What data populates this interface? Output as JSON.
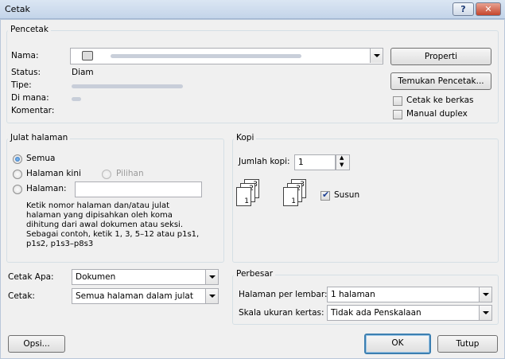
{
  "window": {
    "title": "Cetak",
    "help": "?",
    "close": "✕"
  },
  "printer": {
    "group_label": "Pencetak",
    "name_label": "Nama:",
    "status_label": "Status:",
    "status_value": "Diam",
    "type_label": "Tipe:",
    "where_label": "Di mana:",
    "comment_label": "Komentar:",
    "properties_button": "Properti",
    "find_button": "Temukan Pencetak...",
    "print_to_file_label": "Cetak ke berkas",
    "manual_duplex_label": "Manual duplex"
  },
  "page_range": {
    "group_label": "Julat halaman",
    "all_label": "Semua",
    "current_label": "Halaman kini",
    "selection_label": "Pilihan",
    "pages_label": "Halaman:",
    "pages_value": "",
    "hint": "Ketik nomor halaman dan/atau julat halaman yang dipisahkan oleh koma dihitung dari awal dokumen atau seksi. Sebagai contoh, ketik 1, 3, 5–12 atau p1s1, p1s2, p1s3–p8s3"
  },
  "copies": {
    "group_label": "Kopi",
    "count_label": "Jumlah kopi:",
    "count_value": "1",
    "collate_label": "Susun",
    "collate_checked": true,
    "page_digits": [
      "1",
      "2",
      "3"
    ]
  },
  "print_what": {
    "label": "Cetak Apa:",
    "value": "Dokumen"
  },
  "print": {
    "label": "Cetak:",
    "value": "Semua halaman dalam julat"
  },
  "zoom": {
    "group_label": "Perbesar",
    "pages_per_sheet_label": "Halaman per lembar:",
    "pages_per_sheet_value": "1 halaman",
    "scale_label": "Skala ukuran kertas:",
    "scale_value": "Tidak ada Penskalaan"
  },
  "footer": {
    "options_button": "Opsi...",
    "ok_button": "OK",
    "close_button": "Tutup"
  }
}
